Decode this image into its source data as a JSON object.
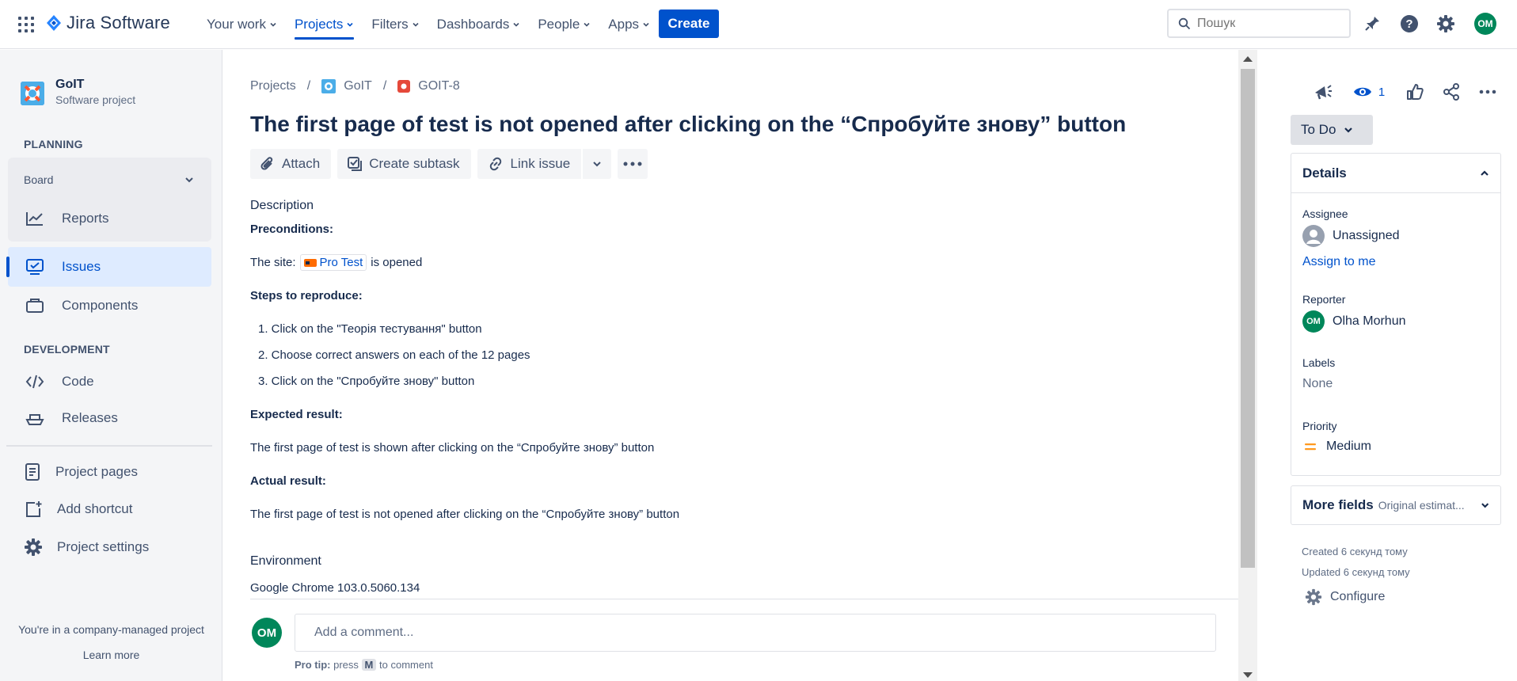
{
  "app": {
    "name": "Jira Software"
  },
  "nav": {
    "items": [
      {
        "label": "Your work",
        "active": false
      },
      {
        "label": "Projects",
        "active": true
      },
      {
        "label": "Filters",
        "active": false
      },
      {
        "label": "Dashboards",
        "active": false
      },
      {
        "label": "People",
        "active": false
      },
      {
        "label": "Apps",
        "active": false
      }
    ],
    "create_label": "Create",
    "search_placeholder": "Пошук",
    "user_initials": "OM"
  },
  "sidebar": {
    "project_name": "GoIT",
    "project_type": "Software project",
    "planning_header": "PLANNING",
    "board_label": "Board",
    "reports_label": "Reports",
    "issues_label": "Issues",
    "components_label": "Components",
    "development_header": "DEVELOPMENT",
    "code_label": "Code",
    "releases_label": "Releases",
    "project_pages_label": "Project pages",
    "add_shortcut_label": "Add shortcut",
    "project_settings_label": "Project settings",
    "footer_text": "You're in a company-managed project",
    "learn_more_label": "Learn more"
  },
  "issue": {
    "breadcrumb": {
      "projects": "Projects",
      "project": "GoIT",
      "key": "GOIT-8"
    },
    "title": "The first page of test is not opened after clicking on the “Спробуйте знову” button",
    "toolbar": {
      "attach": "Attach",
      "create_subtask": "Create subtask",
      "link_issue": "Link issue"
    },
    "description_label": "Description",
    "preconditions_label": "Preconditions:",
    "site_prefix": "The site:",
    "site_link": "Pro Test",
    "site_suffix": "is opened",
    "steps_label": "Steps to reproduce:",
    "steps": [
      "1. Click on the \"Теорія тестування\" button",
      "2. Choose correct answers on each of the 12 pages",
      "3. Click on the \"Спробуйте знову\" button"
    ],
    "expected_label": "Expected result:",
    "expected_text": "The first page of test is shown after clicking on the “Спробуйте знову” button",
    "actual_label": "Actual result:",
    "actual_text": "The first page of test is not opened after clicking on the “Спробуйте знову” button",
    "environment_label": "Environment",
    "environment_value": "Google Chrome 103.0.5060.134",
    "comment_placeholder": "Add a comment...",
    "pro_tip_label": "Pro tip:",
    "pro_tip_press": "press",
    "pro_tip_key": "M",
    "pro_tip_suffix": "to comment"
  },
  "details": {
    "watch_count": "1",
    "status": "To Do",
    "header": "Details",
    "assignee_label": "Assignee",
    "assignee_value": "Unassigned",
    "assign_to_me": "Assign to me",
    "reporter_label": "Reporter",
    "reporter_initials": "OM",
    "reporter_value": "Olha Morhun",
    "labels_label": "Labels",
    "labels_value": "None",
    "priority_label": "Priority",
    "priority_value": "Medium",
    "more_fields_label": "More fields",
    "more_fields_sub": "Original estimat...",
    "created": "Created 6 секунд тому",
    "updated": "Updated 6 секунд тому",
    "configure_label": "Configure"
  },
  "colors": {
    "brand": "#0052cc",
    "avatar": "#00875a",
    "priority_medium": "#ff991f",
    "bug": "#e5493a"
  },
  "icons": [
    "app-switcher-icon",
    "jira-logo-icon",
    "search-icon",
    "notifications-icon",
    "help-icon",
    "settings-icon",
    "attach-icon",
    "subtask-icon",
    "link-icon",
    "more-icon",
    "feedback-icon",
    "eye-icon",
    "like-icon",
    "share-icon",
    "gear-icon"
  ]
}
